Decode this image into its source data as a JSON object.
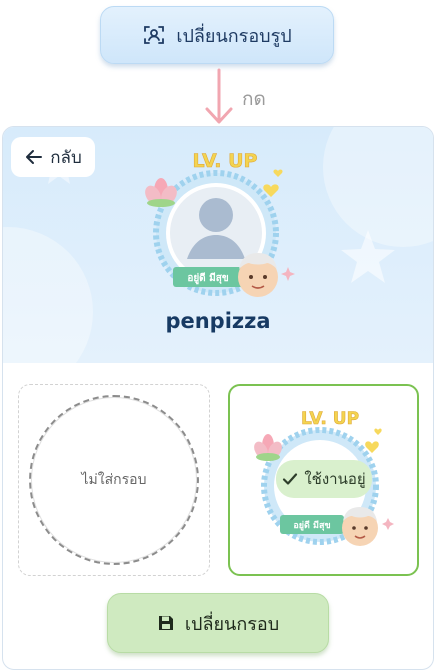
{
  "top_button": {
    "label": "เปลี่ยนกรอบรูป",
    "icon": "face-frame-icon"
  },
  "press_label": "กด",
  "back_button": {
    "label": "กลับ",
    "icon": "arrow-left-icon"
  },
  "profile": {
    "username": "penpizza",
    "frame_title": "LV. UP",
    "badge_text": "อยู่ดี มีสุข"
  },
  "frames": {
    "none_label": "ไม่ใส่กรอบ",
    "lvup": {
      "title": "LV. UP",
      "badge_text": "อยู่ดี มีสุข",
      "in_use_label": "ใช้งานอยู่",
      "in_use_icon": "check-icon"
    }
  },
  "change_button": {
    "label": "เปลี่ยนกรอบ",
    "icon": "save-icon"
  },
  "colors": {
    "accent_blue": "#cfe6fa",
    "accent_green": "#7bc251",
    "button_green": "#cfeac0",
    "arrow_pink": "#f1a6b0",
    "title_navy": "#173a63"
  }
}
